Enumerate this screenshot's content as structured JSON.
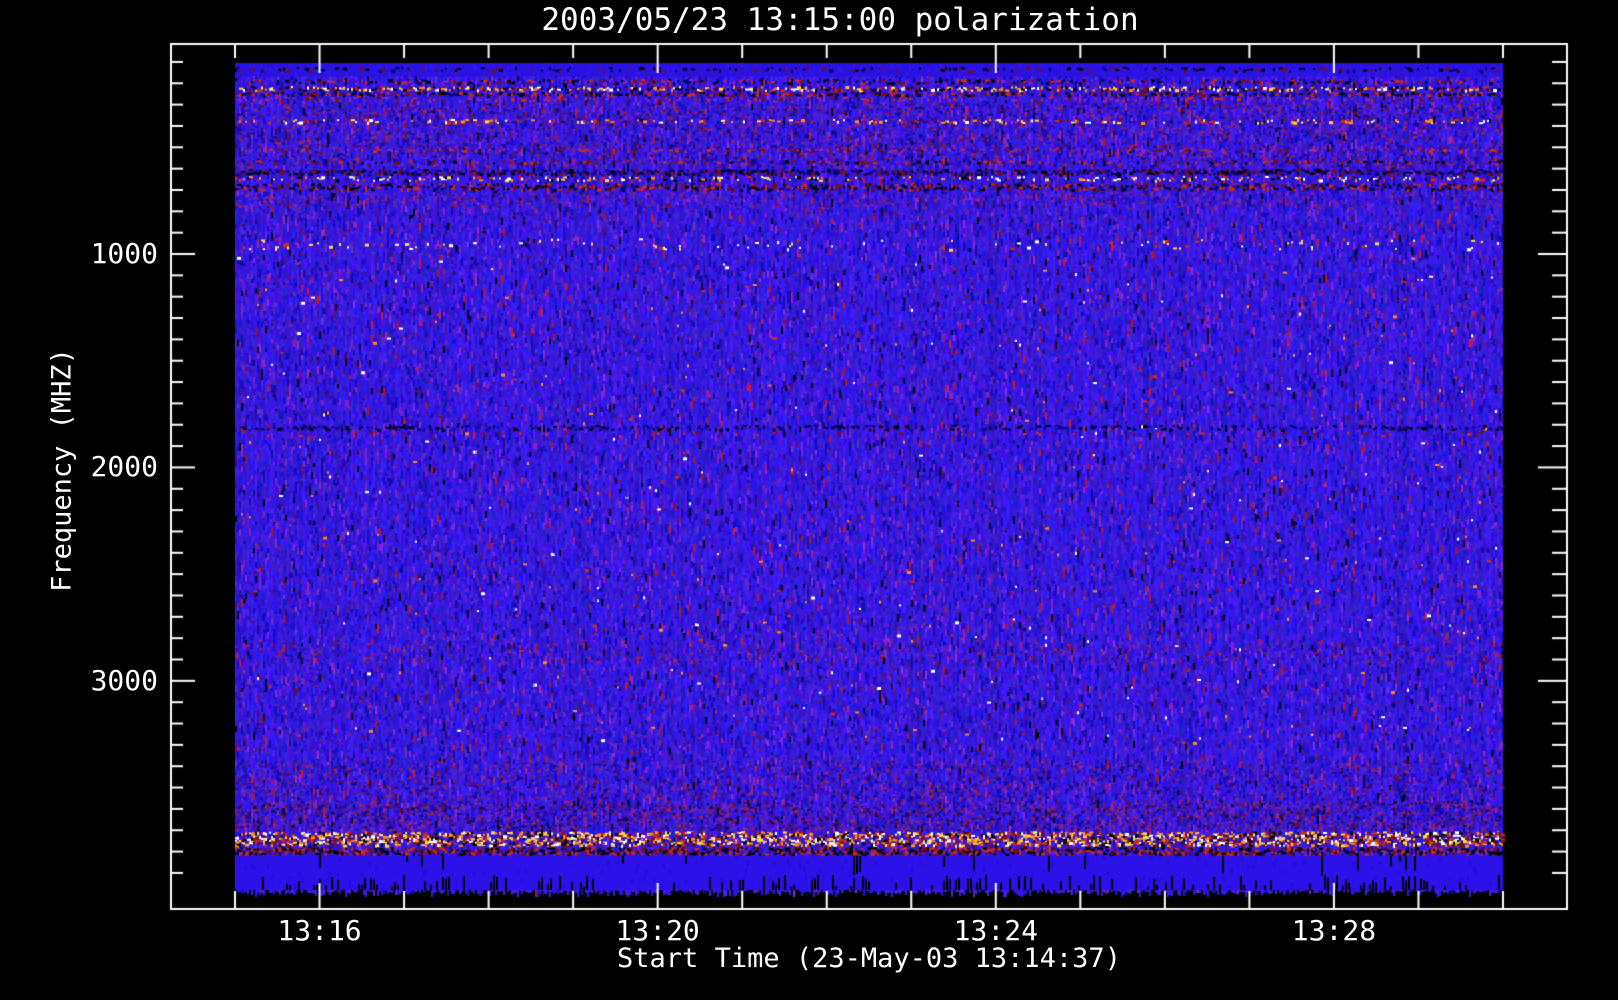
{
  "chart_data": {
    "type": "heatmap",
    "subtype": "radio-spectrogram",
    "title": "2003/05/23 13:15:00 polarization",
    "xlabel": "Start Time (23-May-03 13:14:37)",
    "ylabel": "Frequency (MHZ)",
    "legend_position": "none",
    "grid": false,
    "x_axis": {
      "start_time": "13:14:37",
      "minutes_span": 15,
      "minor_step_minutes": 1,
      "major_ticks": [
        {
          "label": "13:16",
          "minute": 1
        },
        {
          "label": "13:20",
          "minute": 5
        },
        {
          "label": "13:24",
          "minute": 9
        },
        {
          "label": "13:28",
          "minute": 13
        }
      ]
    },
    "y_axis": {
      "unit": "MHz",
      "direction": "increasing-downward",
      "top_mhz": 105,
      "bottom_mhz": 3980,
      "minor_step_mhz": 100,
      "minor_range_mhz": [
        100,
        3900
      ],
      "major_ticks": [
        {
          "label": "1000",
          "mhz": 1000
        },
        {
          "label": "2000",
          "mhz": 2000
        },
        {
          "label": "3000",
          "mhz": 3000
        }
      ]
    },
    "colors": {
      "background": "#000000",
      "frame": "#ffffff",
      "text": "#ffffff",
      "base_blue": "#2a12e2",
      "solid_blue": "#2c11e9",
      "purple": "#7a28c8",
      "red": "#d42a10",
      "darkred": "#7a0e0e",
      "orange": "#ff8c1e",
      "yellow": "#ffd84a",
      "white": "#ffffff",
      "black": "#000000",
      "navy": "#000050",
      "darkblue": "#150a9a"
    },
    "seed": 20030523,
    "bands": [
      {
        "f0": 105,
        "f1": 168,
        "style": "calm"
      },
      {
        "f0": 122,
        "f1": 150,
        "style": "speckle",
        "density": 0.32,
        "palette": [
          "black",
          "navy",
          "darkred"
        ]
      },
      {
        "f0": 180,
        "f1": 207,
        "style": "speckle",
        "density": 0.55,
        "palette": [
          "black",
          "darkred",
          "red",
          "navy",
          "purple"
        ]
      },
      {
        "f0": 213,
        "f1": 240,
        "style": "speckle",
        "density": 0.85,
        "palette": [
          "red",
          "orange",
          "yellow",
          "white",
          "black",
          "darkred",
          "navy"
        ]
      },
      {
        "f0": 240,
        "f1": 263,
        "style": "speckle",
        "density": 0.7,
        "palette": [
          "darkred",
          "red",
          "black",
          "navy"
        ]
      },
      {
        "f0": 263,
        "f1": 287,
        "style": "speckle",
        "density": 0.3,
        "palette": [
          "red",
          "darkred",
          "purple"
        ]
      },
      {
        "f0": 287,
        "f1": 600,
        "style": "mottle",
        "density": 0.33,
        "palette": [
          "purple",
          "darkred",
          "red",
          "darkblue",
          "navy"
        ]
      },
      {
        "f0": 367,
        "f1": 392,
        "style": "speckle",
        "density": 0.28,
        "palette": [
          "orange",
          "yellow",
          "white",
          "red"
        ]
      },
      {
        "f0": 504,
        "f1": 524,
        "style": "speckle",
        "density": 0.26,
        "palette": [
          "red",
          "darkred",
          "purple"
        ]
      },
      {
        "f0": 560,
        "f1": 580,
        "style": "speckle",
        "density": 0.24,
        "palette": [
          "red",
          "darkred",
          "black"
        ]
      },
      {
        "f0": 601,
        "f1": 634,
        "style": "speckle",
        "density": 0.68,
        "palette": [
          "black",
          "navy",
          "darkred",
          "darkblue"
        ]
      },
      {
        "f0": 634,
        "f1": 662,
        "style": "speckle",
        "density": 0.4,
        "palette": [
          "orange",
          "red",
          "white",
          "yellow",
          "black"
        ]
      },
      {
        "f0": 667,
        "f1": 706,
        "style": "speckle",
        "density": 0.55,
        "palette": [
          "black",
          "navy",
          "red",
          "darkred"
        ]
      },
      {
        "f0": 706,
        "f1": 790,
        "style": "mottle",
        "density": 0.3,
        "palette": [
          "purple",
          "darkred",
          "darkblue",
          "red"
        ]
      },
      {
        "f0": 790,
        "f1": 920,
        "style": "mottle",
        "density": 0.12,
        "palette": [
          "purple",
          "darkred",
          "darkblue"
        ]
      },
      {
        "f0": 925,
        "f1": 985,
        "style": "speckle",
        "density": 0.05,
        "palette": [
          "white",
          "yellow",
          "red"
        ]
      },
      {
        "f0": 985,
        "f1": 1795,
        "style": "mottle",
        "density": 0.06,
        "palette": [
          "darkred",
          "purple",
          "darkblue"
        ]
      },
      {
        "f0": 1000,
        "f1": 3300,
        "style": "speckle",
        "density": 0.004,
        "palette": [
          "white",
          "red",
          "orange"
        ]
      },
      {
        "f0": 1800,
        "f1": 1830,
        "style": "speckle",
        "density": 0.3,
        "palette": [
          "navy",
          "darkblue",
          "black"
        ]
      },
      {
        "f0": 1830,
        "f1": 1858,
        "style": "speckle",
        "density": 0.1,
        "palette": [
          "red",
          "darkred"
        ]
      },
      {
        "f0": 1860,
        "f1": 2800,
        "style": "mottle",
        "density": 0.05,
        "palette": [
          "darkred",
          "purple",
          "darkblue"
        ]
      },
      {
        "f0": 2810,
        "f1": 2930,
        "style": "mottle",
        "density": 0.18,
        "palette": [
          "purple",
          "darkred",
          "red",
          "darkblue"
        ]
      },
      {
        "f0": 2930,
        "f1": 3370,
        "style": "mottle",
        "density": 0.08,
        "palette": [
          "purple",
          "darkred",
          "darkblue"
        ]
      },
      {
        "f0": 3370,
        "f1": 3560,
        "style": "mottle",
        "density": 0.28,
        "palette": [
          "darkred",
          "red",
          "purple",
          "navy",
          "darkblue"
        ]
      },
      {
        "f0": 3560,
        "f1": 3705,
        "style": "mottle",
        "density": 0.5,
        "palette": [
          "red",
          "darkred",
          "black",
          "purple",
          "darkblue"
        ]
      },
      {
        "f0": 3705,
        "f1": 3778,
        "style": "speckle",
        "density": 0.8,
        "palette": [
          "red",
          "orange",
          "yellow",
          "white",
          "black",
          "darkred"
        ]
      },
      {
        "f0": 3778,
        "f1": 3820,
        "style": "speckle",
        "density": 0.9,
        "palette": [
          "black",
          "darkred",
          "red",
          "black"
        ]
      },
      {
        "f0": 3820,
        "f1": 3980,
        "style": "solid",
        "color": "solid_blue"
      },
      {
        "f0": 3820,
        "f1": 3900,
        "style": "hang_dashes",
        "density": 0.05
      },
      {
        "f0": 3915,
        "f1": 3980,
        "style": "edge_dashes",
        "density": 0.3
      }
    ]
  }
}
